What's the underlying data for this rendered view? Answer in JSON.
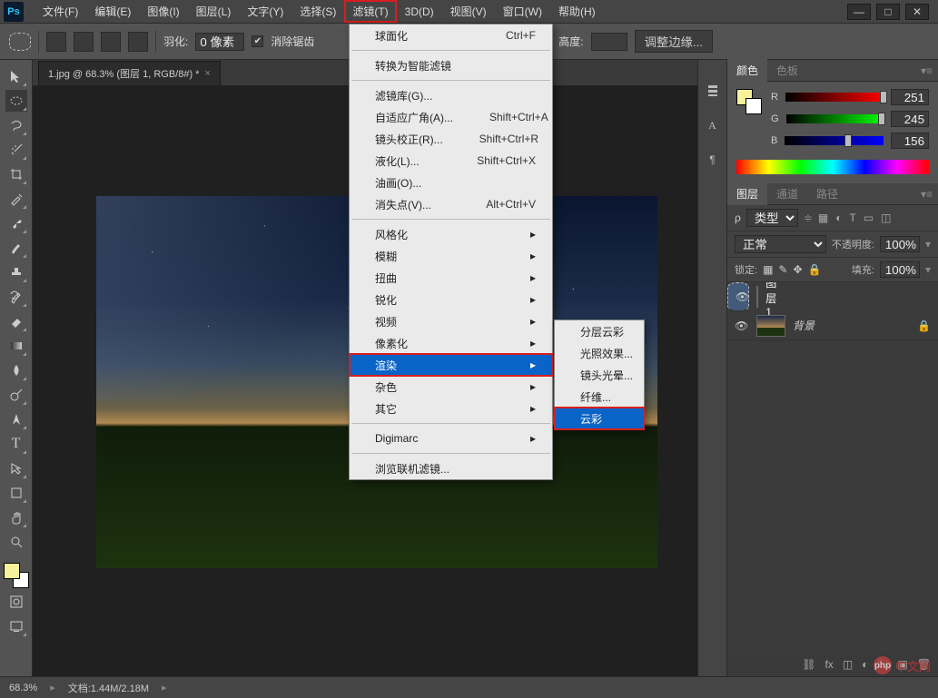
{
  "app": {
    "logo_text": "Ps"
  },
  "menubar": {
    "items": [
      {
        "label": "文件(F)"
      },
      {
        "label": "编辑(E)"
      },
      {
        "label": "图像(I)"
      },
      {
        "label": "图层(L)"
      },
      {
        "label": "文字(Y)"
      },
      {
        "label": "选择(S)"
      },
      {
        "label": "滤镜(T)",
        "active": true
      },
      {
        "label": "3D(D)"
      },
      {
        "label": "视图(V)"
      },
      {
        "label": "窗口(W)"
      },
      {
        "label": "帮助(H)"
      }
    ]
  },
  "win_controls": {
    "min": "—",
    "max": "□",
    "close": "✕"
  },
  "optbar": {
    "feather_label": "羽化:",
    "feather_value": "0 像素",
    "antialias_label": "消除锯齿",
    "antialias_checked": true,
    "height_label": "高度:",
    "height_value": "",
    "refine_edge": "调整边缘..."
  },
  "doc": {
    "tab_title": "1.jpg @ 68.3% (图层 1, RGB/8#) *"
  },
  "filter_menu": {
    "last": {
      "label": "球面化",
      "shortcut": "Ctrl+F"
    },
    "smart": "转换为智能滤镜",
    "gallery": "滤镜库(G)...",
    "adaptive": {
      "label": "自适应广角(A)...",
      "shortcut": "Shift+Ctrl+A"
    },
    "lens": {
      "label": "镜头校正(R)...",
      "shortcut": "Shift+Ctrl+R"
    },
    "liquify": {
      "label": "液化(L)...",
      "shortcut": "Shift+Ctrl+X"
    },
    "oil": "油画(O)...",
    "vanish": {
      "label": "消失点(V)...",
      "shortcut": "Alt+Ctrl+V"
    },
    "groups": [
      "风格化",
      "模糊",
      "扭曲",
      "锐化",
      "视频",
      "像素化",
      "渲染",
      "杂色",
      "其它"
    ],
    "digimarc": "Digimarc",
    "browse": "浏览联机滤镜..."
  },
  "render_sub": {
    "items": [
      "分层云彩",
      "光照效果...",
      "镜头光晕...",
      "纤维...",
      "云彩"
    ]
  },
  "iconcol": {
    "names": [
      "history-icon",
      "character-icon",
      "paragraph-icon"
    ]
  },
  "color_panel": {
    "tab_color": "颜色",
    "tab_swatch": "色板",
    "r_label": "R",
    "r_val": "251",
    "g_label": "G",
    "g_val": "245",
    "b_label": "B",
    "b_val": "156"
  },
  "layers_panel": {
    "tab_layers": "图层",
    "tab_channels": "通道",
    "tab_paths": "路径",
    "kind_label": "类型",
    "blend_mode": "正常",
    "opacity_label": "不透明度:",
    "opacity_val": "100%",
    "lock_label": "锁定:",
    "fill_label": "填充:",
    "fill_val": "100%",
    "layer1_name": "图层 1",
    "bg_name": "背景"
  },
  "status": {
    "zoom": "68.3%",
    "doc_label": "文档:",
    "doc_size": "1.44M/2.18M"
  },
  "watermark": "中文网"
}
